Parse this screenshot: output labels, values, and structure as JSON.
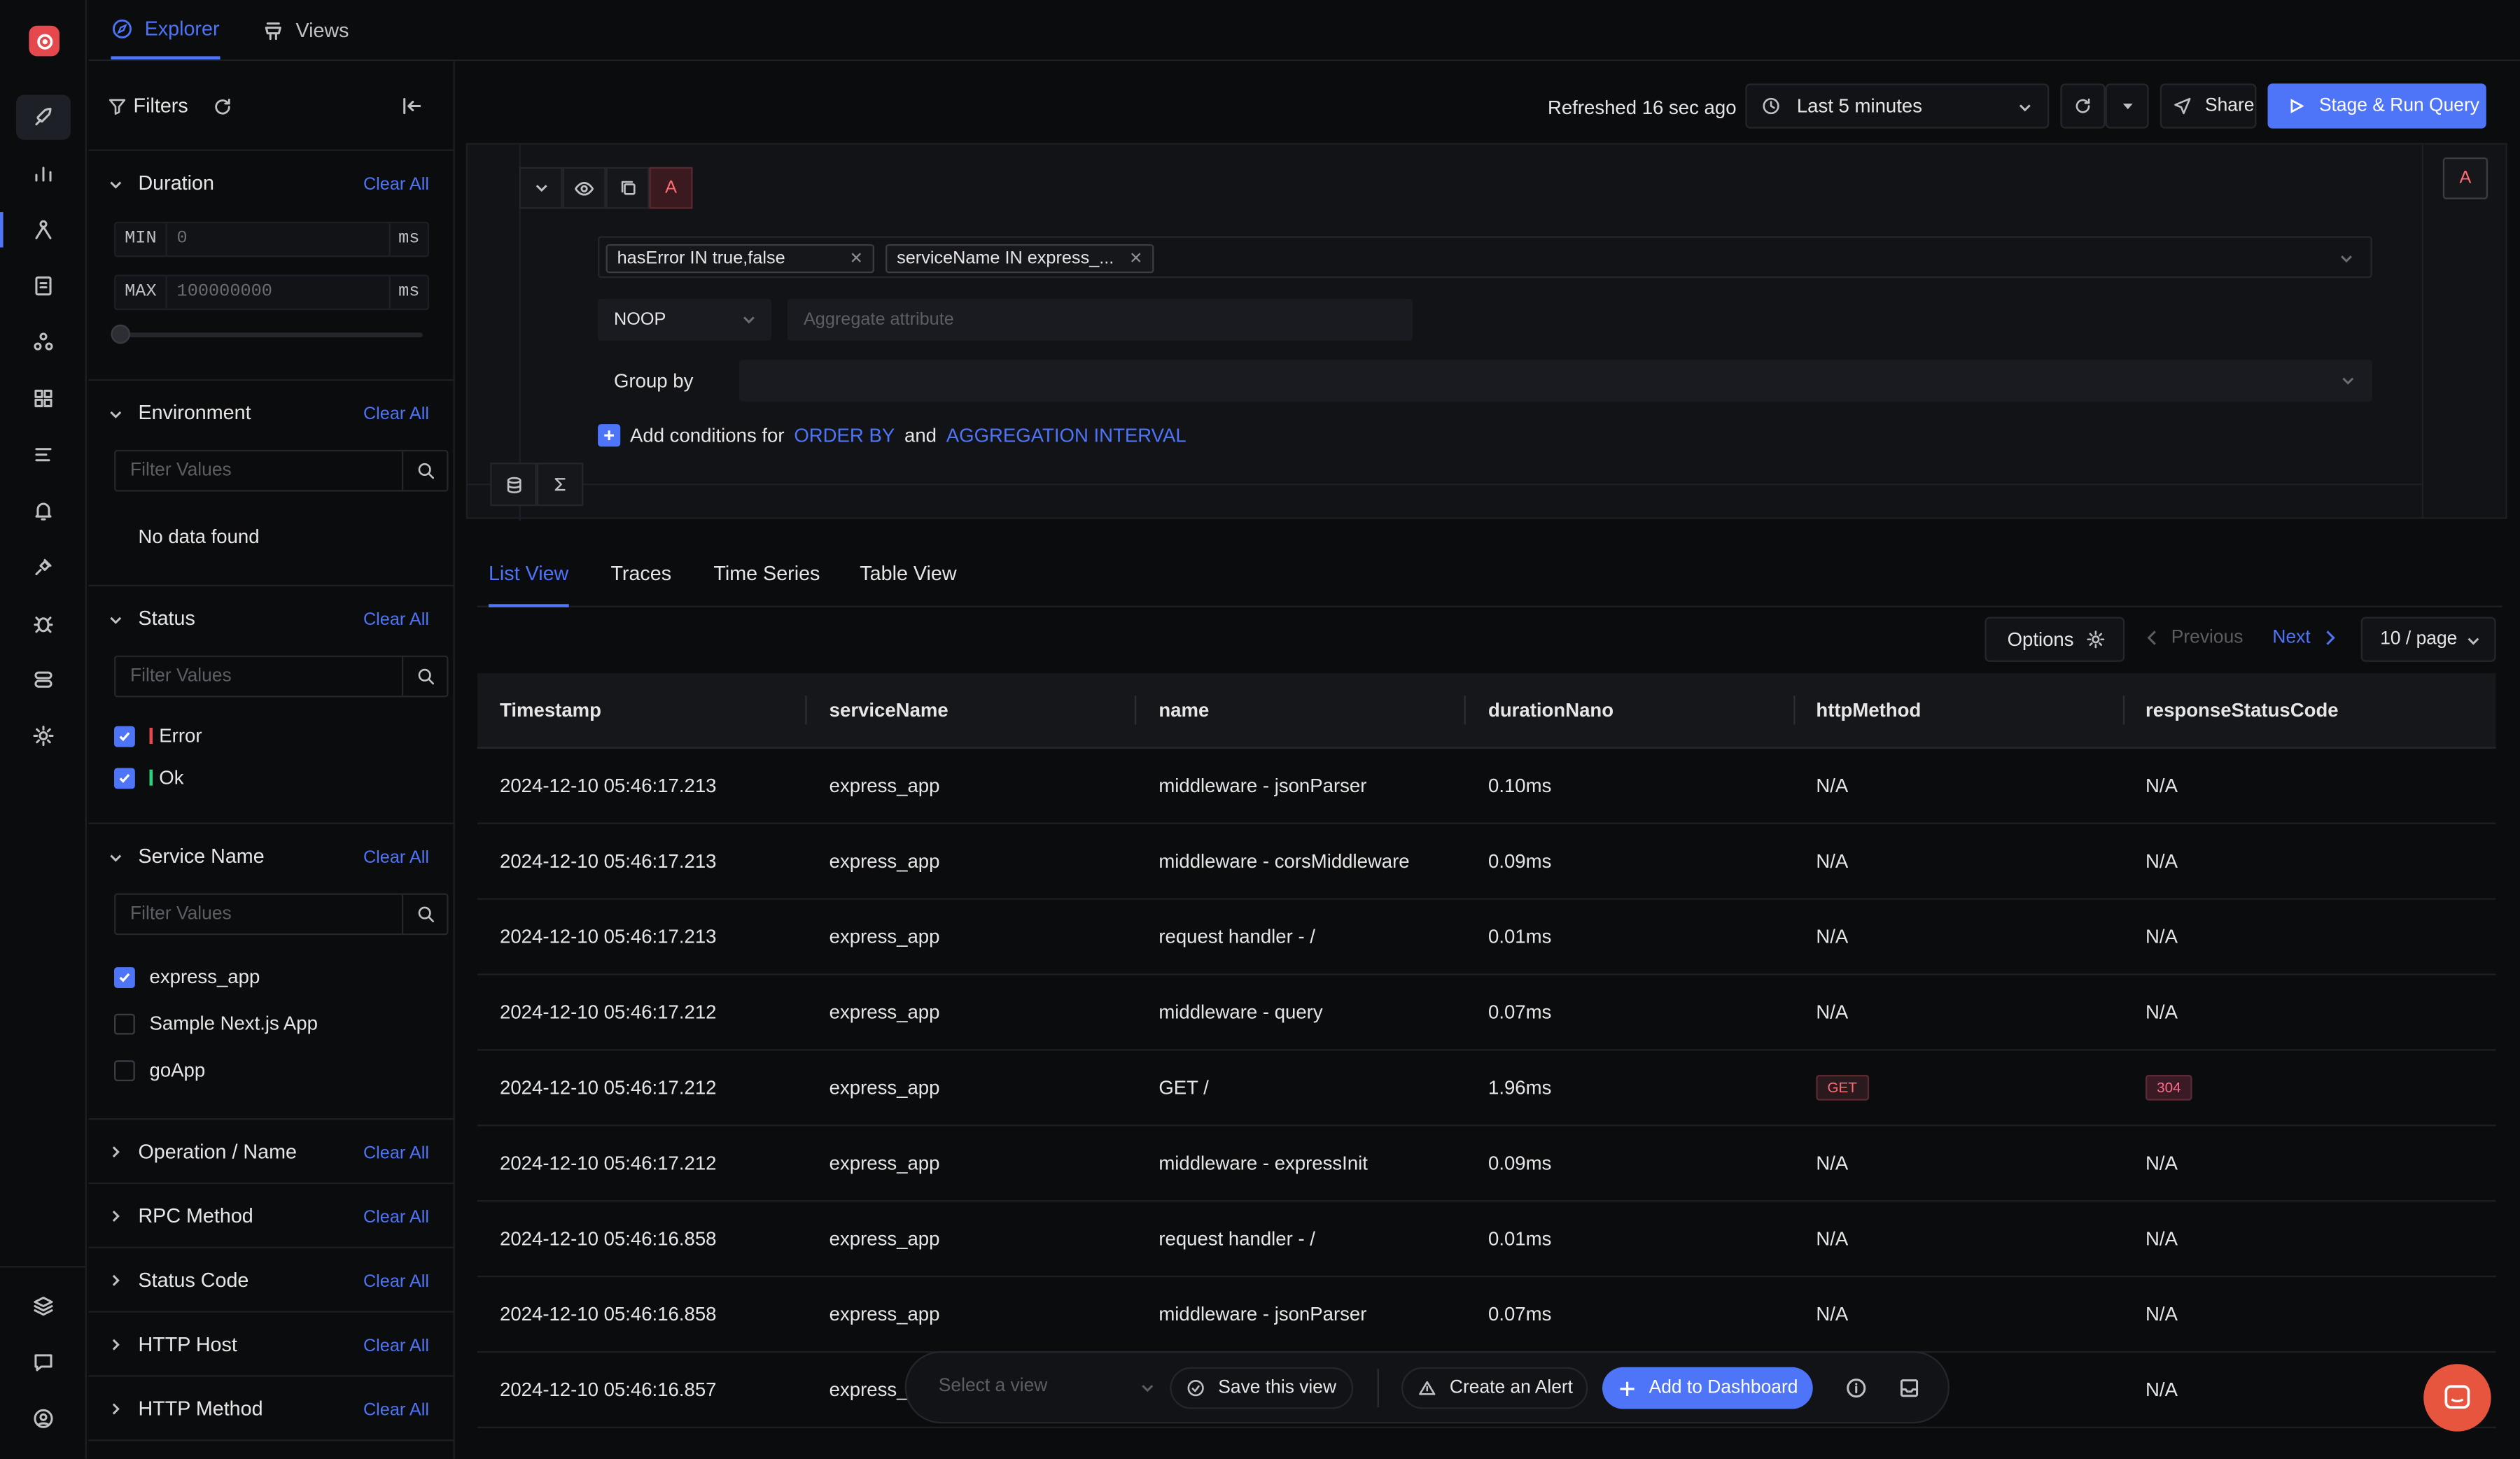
{
  "nav": {
    "tabs": [
      {
        "label": "Explorer"
      },
      {
        "label": "Views"
      }
    ]
  },
  "filters": {
    "title": "Filters",
    "clear_label": "Clear All",
    "duration": {
      "title": "Duration",
      "min_label": "MIN",
      "min_placeholder": "0",
      "max_label": "MAX",
      "max_placeholder": "100000000",
      "unit": "ms"
    },
    "environment": {
      "title": "Environment",
      "placeholder": "Filter Values",
      "empty": "No data found"
    },
    "status": {
      "title": "Status",
      "placeholder": "Filter Values",
      "options": [
        {
          "label": "Error"
        },
        {
          "label": "Ok"
        }
      ]
    },
    "service_name": {
      "title": "Service Name",
      "placeholder": "Filter Values",
      "options": [
        {
          "label": "express_app"
        },
        {
          "label": "Sample Next.js App"
        },
        {
          "label": "goApp"
        }
      ]
    },
    "collapsed": [
      {
        "title": "Operation / Name"
      },
      {
        "title": "RPC Method"
      },
      {
        "title": "Status Code"
      },
      {
        "title": "HTTP Host"
      },
      {
        "title": "HTTP Method"
      }
    ]
  },
  "header": {
    "refreshed": "Refreshed 16 sec ago",
    "time_range": "Last 5 minutes",
    "share": "Share",
    "run": "Stage & Run Query"
  },
  "query": {
    "label": "A",
    "chips": [
      "hasError IN true,false",
      "serviceName IN express_..."
    ],
    "aggregate_op": "NOOP",
    "aggregate_placeholder": "Aggregate attribute",
    "group_by": "Group by",
    "add_conditions": {
      "prefix": "Add conditions for",
      "order_by": "ORDER BY",
      "and": "and",
      "interval": "AGGREGATION INTERVAL"
    }
  },
  "views": {
    "tabs": [
      "List View",
      "Traces",
      "Time Series",
      "Table View"
    ],
    "options": "Options",
    "previous": "Previous",
    "next": "Next",
    "page_size": "10 / page"
  },
  "table": {
    "columns": [
      "Timestamp",
      "serviceName",
      "name",
      "durationNano",
      "httpMethod",
      "responseStatusCode"
    ],
    "rows": [
      {
        "ts": "2024-12-10 05:46:17.213",
        "svc": "express_app",
        "name": "middleware - jsonParser",
        "dur": "0.10ms",
        "method": "N/A",
        "status": "N/A"
      },
      {
        "ts": "2024-12-10 05:46:17.213",
        "svc": "express_app",
        "name": "middleware - corsMiddleware",
        "dur": "0.09ms",
        "method": "N/A",
        "status": "N/A"
      },
      {
        "ts": "2024-12-10 05:46:17.213",
        "svc": "express_app",
        "name": "request handler - /",
        "dur": "0.01ms",
        "method": "N/A",
        "status": "N/A"
      },
      {
        "ts": "2024-12-10 05:46:17.212",
        "svc": "express_app",
        "name": "middleware - query",
        "dur": "0.07ms",
        "method": "N/A",
        "status": "N/A"
      },
      {
        "ts": "2024-12-10 05:46:17.212",
        "svc": "express_app",
        "name": "GET /",
        "dur": "1.96ms",
        "method": "GET",
        "status": "304"
      },
      {
        "ts": "2024-12-10 05:46:17.212",
        "svc": "express_app",
        "name": "middleware - expressInit",
        "dur": "0.09ms",
        "method": "N/A",
        "status": "N/A"
      },
      {
        "ts": "2024-12-10 05:46:16.858",
        "svc": "express_app",
        "name": "request handler - /",
        "dur": "0.01ms",
        "method": "N/A",
        "status": "N/A"
      },
      {
        "ts": "2024-12-10 05:46:16.858",
        "svc": "express_app",
        "name": "middleware - jsonParser",
        "dur": "0.07ms",
        "method": "N/A",
        "status": "N/A"
      },
      {
        "ts": "2024-12-10 05:46:16.857",
        "svc": "express_",
        "name": "",
        "dur": "",
        "method": "",
        "status": "N/A"
      }
    ]
  },
  "bottom_bar": {
    "select_view": "Select a view",
    "save_view": "Save this view",
    "create_alert": "Create an Alert",
    "add_dashboard": "Add to Dashboard"
  },
  "colors": {
    "accent": "#4e74f8",
    "error": "#e5484d",
    "ok": "#2bd17e",
    "brand": "#e5484d"
  }
}
